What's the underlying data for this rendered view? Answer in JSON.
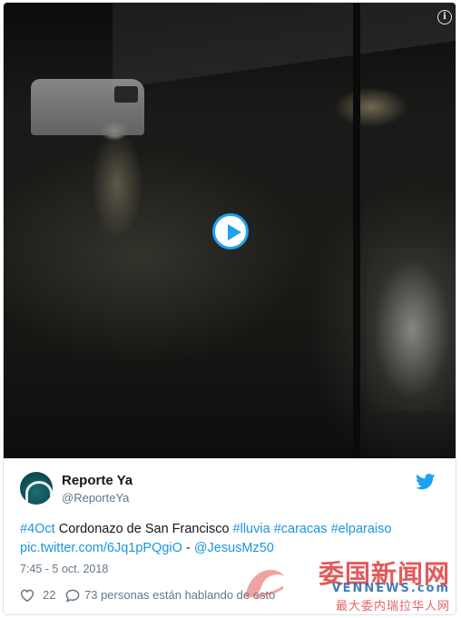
{
  "tweet": {
    "author_name": "Reporte Ya",
    "author_handle": "@ReporteYa",
    "text_segments": [
      {
        "text": "#4Oct",
        "link": true
      },
      {
        "text": " Cordonazo de San Francisco ",
        "link": false
      },
      {
        "text": "#lluvia",
        "link": true
      },
      {
        "text": " ",
        "link": false
      },
      {
        "text": "#caracas",
        "link": true
      },
      {
        "text": " ",
        "link": false
      },
      {
        "text": "#elparaiso",
        "link": true
      },
      {
        "text": " ",
        "link": false
      },
      {
        "text": "pic.twitter.com/6Jq1pPQgiO",
        "link": true
      },
      {
        "text": " - ",
        "link": false
      },
      {
        "text": "@JesusMz50",
        "link": true
      }
    ],
    "timestamp": "7:45 - 5 oct. 2018",
    "likes": "22",
    "talking": "73 personas están hablando de esto"
  },
  "media": {
    "type": "video",
    "play_icon": "play-icon",
    "info_icon": "info-icon",
    "info_glyph": "i"
  },
  "icons": {
    "brand": "twitter-bird-icon",
    "like": "heart-icon",
    "reply": "comment-icon"
  },
  "watermark": {
    "cn": "委国新闻网",
    "en": "VENNEWS.com",
    "sub": "最大委内瑞拉华人网"
  },
  "colors": {
    "link": "#1b95e0",
    "play_accent": "#1da1f2",
    "muted": "#657786",
    "text": "#14171a",
    "watermark_red": "#e14b4b",
    "watermark_blue": "#2f6fb3"
  }
}
